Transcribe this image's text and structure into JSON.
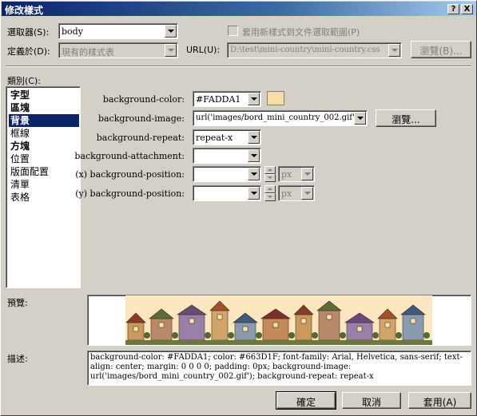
{
  "window": {
    "title": "修改樣式",
    "help_btn": "?",
    "close_btn": "X"
  },
  "selector": {
    "label": "選取器(S):",
    "value": "body",
    "checkbox_label": "套用新樣式到文件選取範圍(P)",
    "checked": false
  },
  "defined_in": {
    "label": "定義於(D):",
    "value": "現有的樣式表",
    "url_label": "URL(U):",
    "url_value": "D:\\test\\mini-country\\mini-country.css",
    "browse": "瀏覽(B)..."
  },
  "category": {
    "label": "類別(C):",
    "items": [
      {
        "label": "字型",
        "bold": true
      },
      {
        "label": "區塊",
        "bold": true
      },
      {
        "label": "背景",
        "bold": true,
        "selected": true
      },
      {
        "label": "框線",
        "bold": false
      },
      {
        "label": "方塊",
        "bold": true
      },
      {
        "label": "位置",
        "bold": false
      },
      {
        "label": "版面配置",
        "bold": false
      },
      {
        "label": "清單",
        "bold": false
      },
      {
        "label": "表格",
        "bold": false
      }
    ]
  },
  "props": {
    "bg_color": {
      "label": "background-color:",
      "value": "#FADDA1",
      "swatch": "#FADDA1"
    },
    "bg_image": {
      "label": "background-image:",
      "value": "url('images/bord_mini_country_002.gif')",
      "browse": "瀏覽..."
    },
    "bg_repeat": {
      "label": "background-repeat:",
      "value": "repeat-x"
    },
    "bg_attach": {
      "label": "background-attachment:",
      "value": ""
    },
    "bg_pos_x": {
      "label": "(x) background-position:",
      "value": "",
      "unit": "px"
    },
    "bg_pos_y": {
      "label": "(y) background-position:",
      "value": "",
      "unit": "px"
    }
  },
  "preview": {
    "label": "預覽:"
  },
  "description": {
    "label": "描述:",
    "text": "background-color: #FADDA1; color: #663D1F; font-family: Arial, Helvetica, sans-serif; text-align: center; margin: 0 0 0 0; padding: 0px; background-image: url('images/bord_mini_country_002.gif'); background-repeat: repeat-x"
  },
  "buttons": {
    "ok": "確定",
    "cancel": "取消",
    "apply": "套用(A)"
  }
}
